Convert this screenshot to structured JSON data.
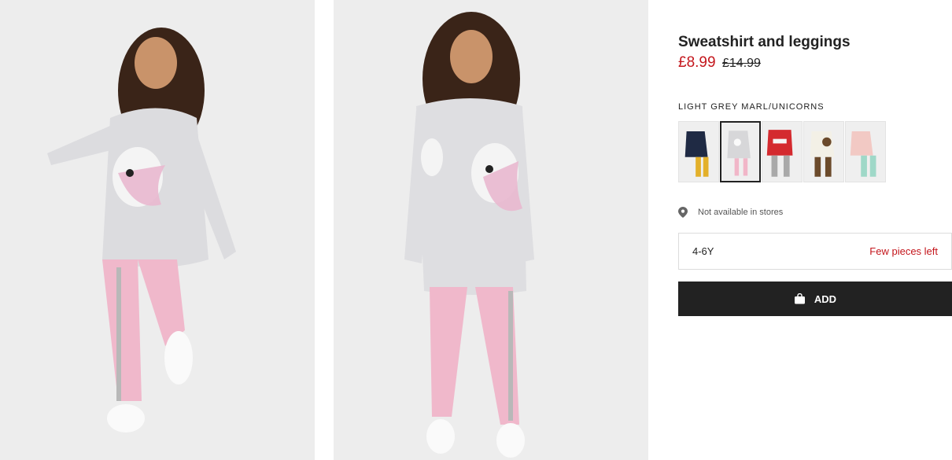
{
  "gallery": {
    "images": [
      {
        "icon": "product-photo",
        "alt": ""
      },
      {
        "icon": "product-photo",
        "alt": ""
      }
    ]
  },
  "product": {
    "title": "Sweatshirt and leggings",
    "price_now": "£8.99",
    "price_was": "£14.99",
    "color_name": "LIGHT GREY MARL/UNICORNS",
    "sale_color": "#c4161c"
  },
  "swatches": [
    {
      "top_color": "#1f2a44",
      "bottom_color": "#e3b02a",
      "selected": false
    },
    {
      "top_color": "#d7d7d9",
      "bottom_color": "#f1b6c8",
      "selected": true
    },
    {
      "top_color": "#d42a2f",
      "bottom_color": "#a9a9a9",
      "selected": false
    },
    {
      "top_color": "#f3f0e6",
      "bottom_color": "#6b4a2b",
      "selected": false
    },
    {
      "top_color": "#f2c9c4",
      "bottom_color": "#9fd8c8",
      "selected": false
    }
  ],
  "store": {
    "icon": "location-pin-icon",
    "text": "Not available in stores"
  },
  "size": {
    "label": "4-6Y",
    "stock": "Few pieces left"
  },
  "add_button": {
    "icon": "shopping-bag-icon",
    "label": "ADD"
  }
}
